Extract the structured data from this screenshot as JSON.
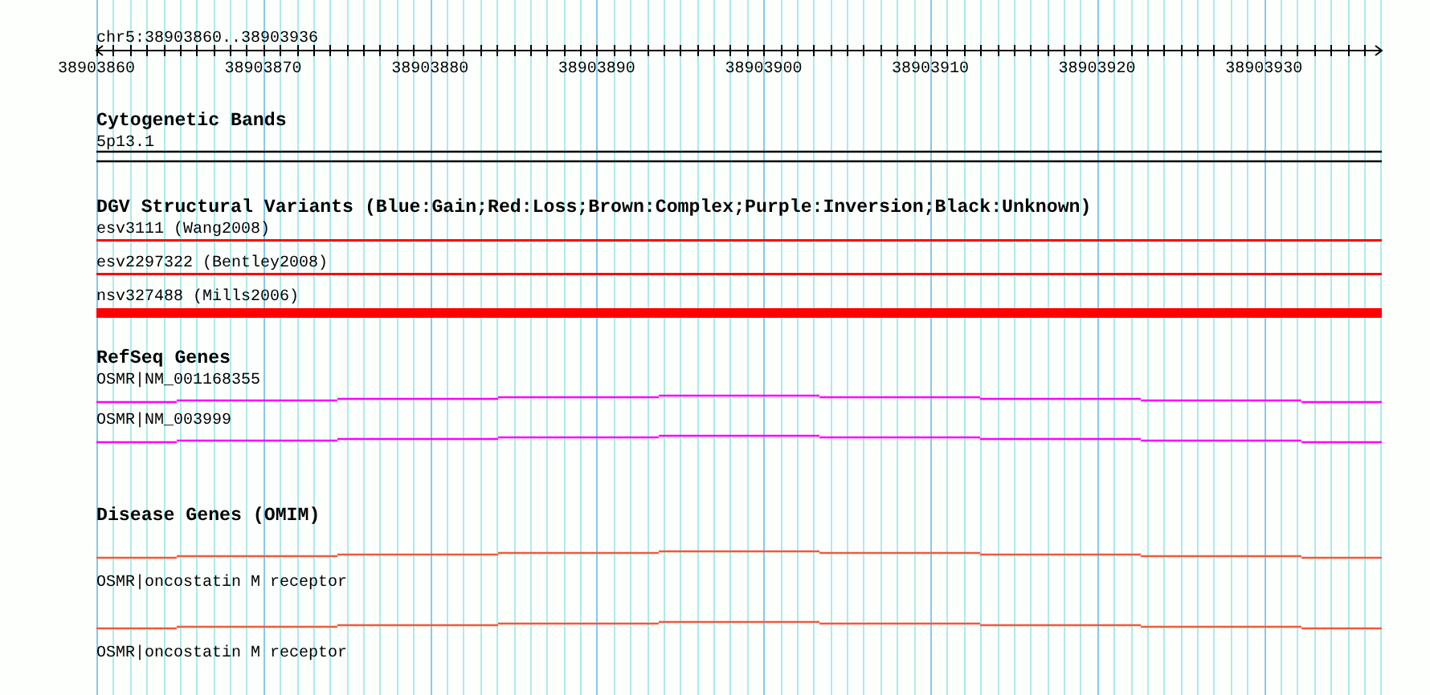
{
  "ruler": {
    "title": "chr5:38903860..38903936",
    "labels": [
      "38903860",
      "38903870",
      "38903880",
      "38903890",
      "38903900",
      "38903910",
      "38903920",
      "38903930"
    ]
  },
  "tracks": [
    {
      "kind": "bands",
      "title": "Cytogenetic Bands",
      "features": [
        {
          "label": "5p13.1",
          "color": "#000000"
        }
      ]
    },
    {
      "kind": "variants",
      "title": "DGV Structural Variants (Blue:Gain;Red:Loss;Brown:Complex;Purple:Inversion;Black:Unknown)",
      "features": [
        {
          "label": "esv3111 (Wang2008)",
          "kind": "thin",
          "color": "#ff0000"
        },
        {
          "label": "esv2297322 (Bentley2008)",
          "kind": "thin",
          "color": "#ff0000"
        },
        {
          "label": "nsv327488 (Mills2006)",
          "kind": "thick",
          "color": "#ff0000"
        }
      ]
    },
    {
      "kind": "genes",
      "title": "RefSeq Genes",
      "features": [
        {
          "label": "OSMR|NM_001168355",
          "color": "#ff00ff"
        },
        {
          "label": "OSMR|NM_003999",
          "color": "#ff00ff"
        }
      ]
    },
    {
      "kind": "omim",
      "title": "Disease Genes (OMIM)",
      "features": [
        {
          "label": "OSMR|oncostatin M receptor",
          "color": "#f05a3c"
        },
        {
          "label": "OSMR|oncostatin M receptor",
          "color": "#f05a3c"
        }
      ]
    }
  ]
}
